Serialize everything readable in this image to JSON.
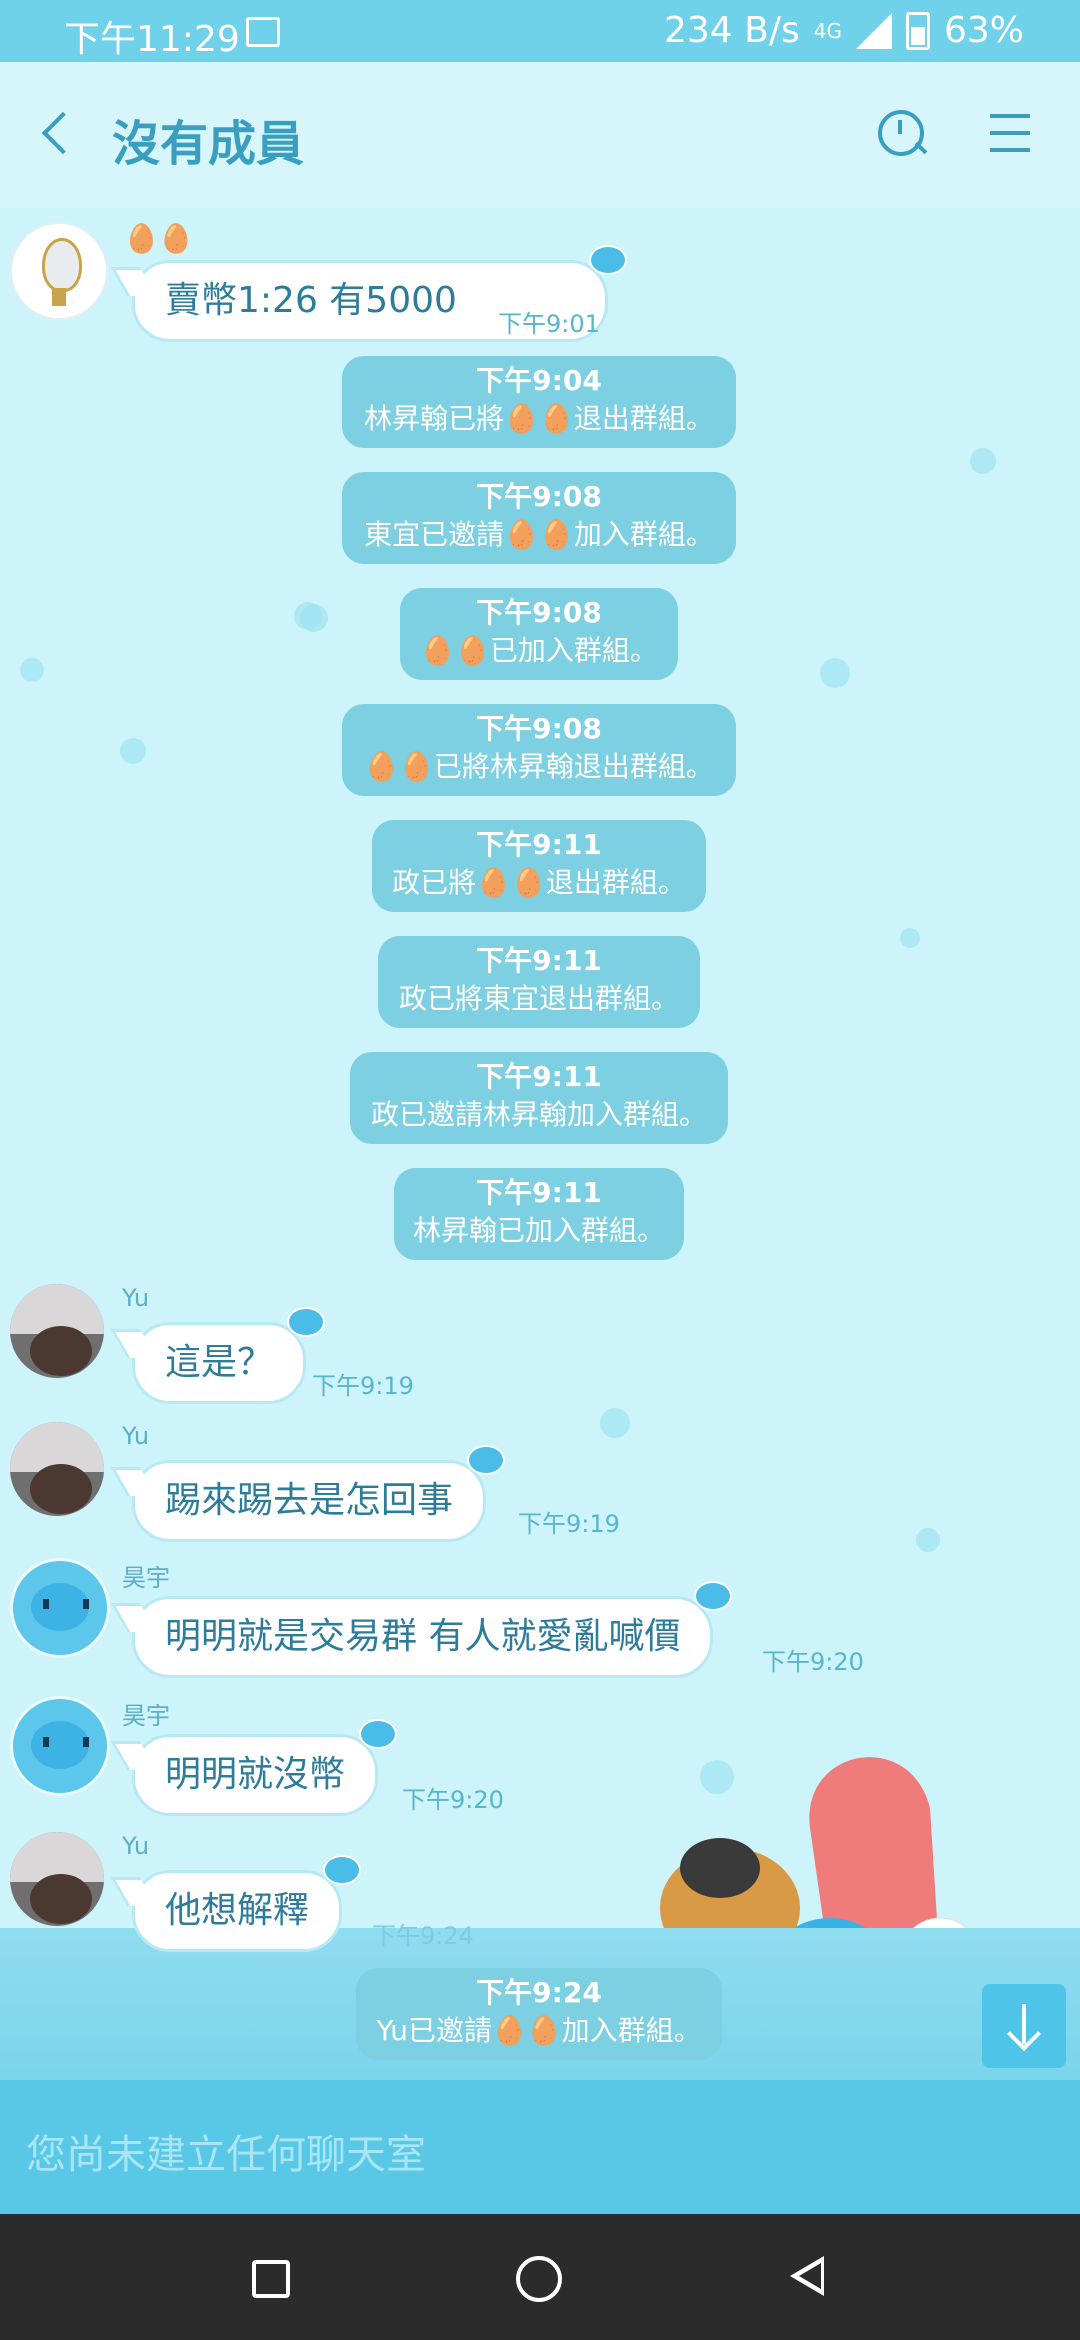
{
  "status_bar": {
    "time": "下午11:29",
    "speed": "234 B/s",
    "network": "4G",
    "battery": "63%"
  },
  "header": {
    "title": "沒有成員",
    "icons": [
      "back-arrow-icon",
      "search-clock-icon",
      "menu-icon"
    ]
  },
  "messages": [
    {
      "sender": "🥚🥚",
      "text": "賣幣1:26 有5000",
      "time": "下午9:01"
    },
    {
      "sys_time": "下午9:04",
      "sys_text": "林昇翰已將🥚🥚退出群組。"
    },
    {
      "sys_time": "下午9:08",
      "sys_text": "東宜已邀請🥚🥚加入群組。"
    },
    {
      "sys_time": "下午9:08",
      "sys_text": "🥚🥚已加入群組。"
    },
    {
      "sys_time": "下午9:08",
      "sys_text": "🥚🥚已將林昇翰退出群組。"
    },
    {
      "sys_time": "下午9:11",
      "sys_text": "政已將🥚🥚退出群組。"
    },
    {
      "sys_time": "下午9:11",
      "sys_text": "政已將東宜退出群組。"
    },
    {
      "sys_time": "下午9:11",
      "sys_text": "政已邀請林昇翰加入群組。"
    },
    {
      "sys_time": "下午9:11",
      "sys_text": "林昇翰已加入群組。"
    },
    {
      "sender": "Yu",
      "text": "這是？",
      "time": "下午9:19"
    },
    {
      "sender": "Yu",
      "text": "踢來踢去是怎回事",
      "time": "下午9:19"
    },
    {
      "sender": "昊宇",
      "text": "明明就是交易群 有人就愛亂喊價",
      "time": "下午9:20"
    },
    {
      "sender": "昊宇",
      "text": "明明就沒幣",
      "time": "下午9:20"
    },
    {
      "sender": "Yu",
      "text": "他想解釋",
      "time": "下午9:24"
    },
    {
      "sys_time": "下午9:24",
      "sys_text": "Yu已邀請🥚🥚加入群組。"
    }
  ],
  "input": {
    "placeholder": "您尚未建立任何聊天室"
  },
  "colors": {
    "accent": "#3a9ec1",
    "system_bubble": "#7dcfe2",
    "status_bar": "#6fd2ea",
    "input_bar": "#58c8e6",
    "nav_bar": "#2b2b2b"
  }
}
